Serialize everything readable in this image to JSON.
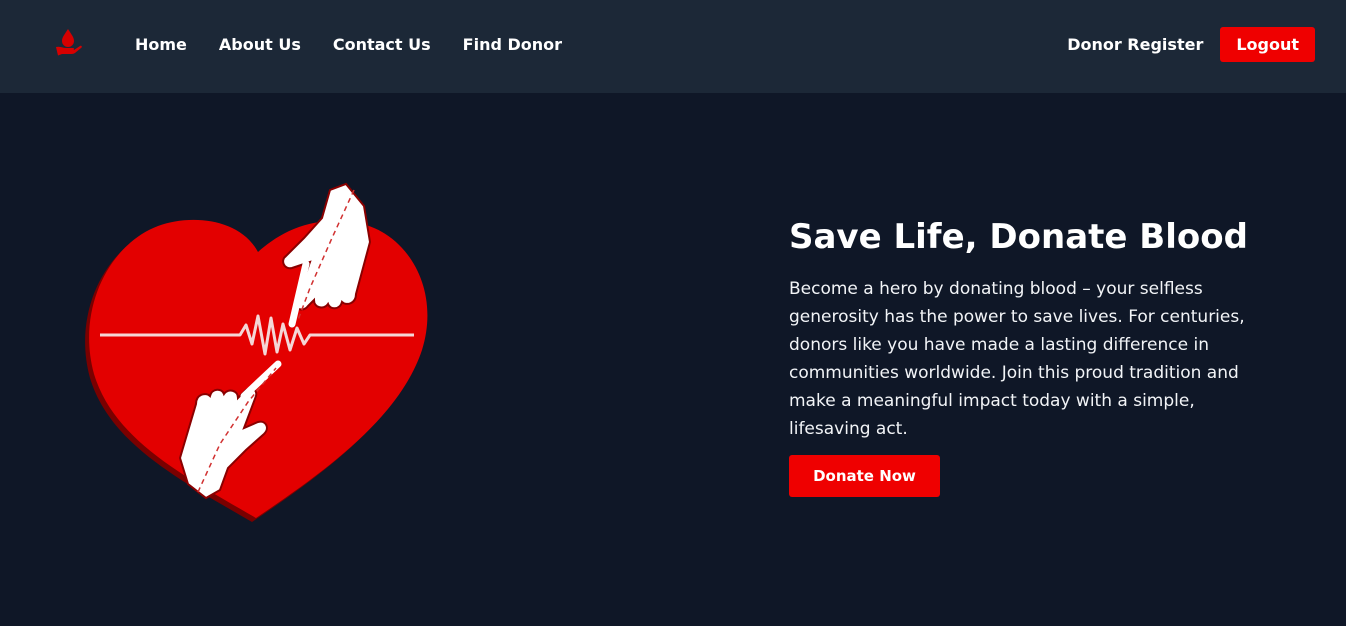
{
  "navbar": {
    "logo_icon": "blood-drop-hand-icon",
    "links": [
      {
        "label": "Home"
      },
      {
        "label": "About Us"
      },
      {
        "label": "Contact Us"
      },
      {
        "label": "Find Donor"
      }
    ],
    "register_label": "Donor Register",
    "logout_label": "Logout"
  },
  "hero": {
    "illustration_icon": "heart-hands-heartbeat-icon",
    "title": "Save Life, Donate Blood",
    "description": "Become a hero by donating blood – your selfless generosity has the power to save lives. For centuries, donors like you have made a lasting difference in communities worldwide. Join this proud tradition and make a meaningful impact today with a simple, lifesaving act.",
    "cta_label": "Donate Now"
  },
  "colors": {
    "page_background": "#0f1727",
    "navbar_background": "#1c2837",
    "accent_red": "#ef0000",
    "heart_red": "#e30000",
    "text_white": "#ffffff"
  }
}
